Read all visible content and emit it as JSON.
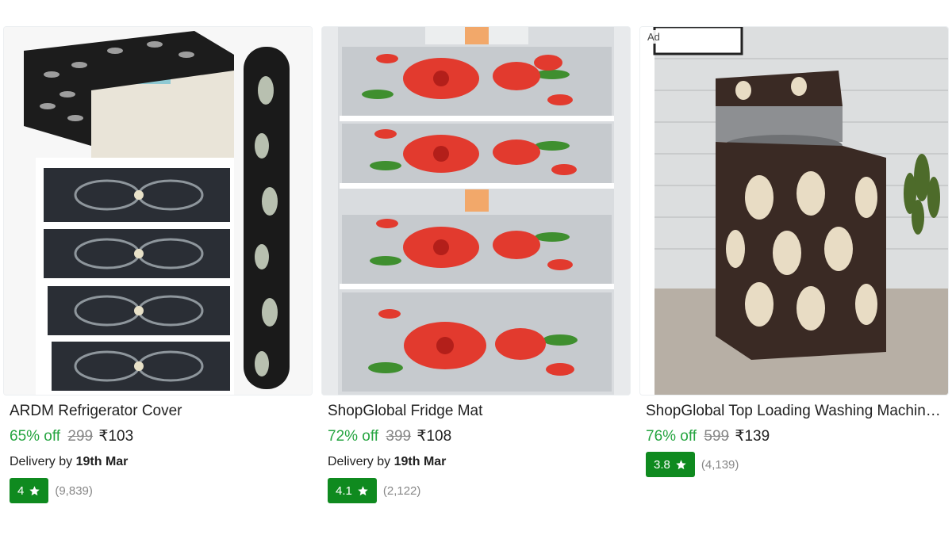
{
  "products": [
    {
      "name": "ARDM Refrigerator Cover",
      "discount": "65% off",
      "mrp": "299",
      "price": "₹103",
      "delivery_prefix": "Delivery by",
      "delivery_date": "19th Mar",
      "rating": "4",
      "reviews": "(9,839)",
      "image": "fridge-cover-set-image"
    },
    {
      "name": "ShopGlobal Fridge Mat",
      "discount": "72% off",
      "mrp": "399",
      "price": "₹108",
      "delivery_prefix": "Delivery by",
      "delivery_date": "19th Mar",
      "rating": "4.1",
      "reviews": "(2,122)",
      "image": "rose-fridge-mat-image"
    },
    {
      "name": "ShopGlobal Top Loading Washing Machine Cover",
      "discount": "76% off",
      "mrp": "599",
      "price": "₹139",
      "rating": "3.8",
      "reviews": "(4,139)",
      "ad_label": "Ad",
      "image": "washing-machine-cover-image"
    }
  ],
  "colors": {
    "discount_green": "#26a541",
    "rating_badge_green": "#0f8a1f",
    "muted_gray": "#878787"
  },
  "icons": [
    "star-icon"
  ]
}
